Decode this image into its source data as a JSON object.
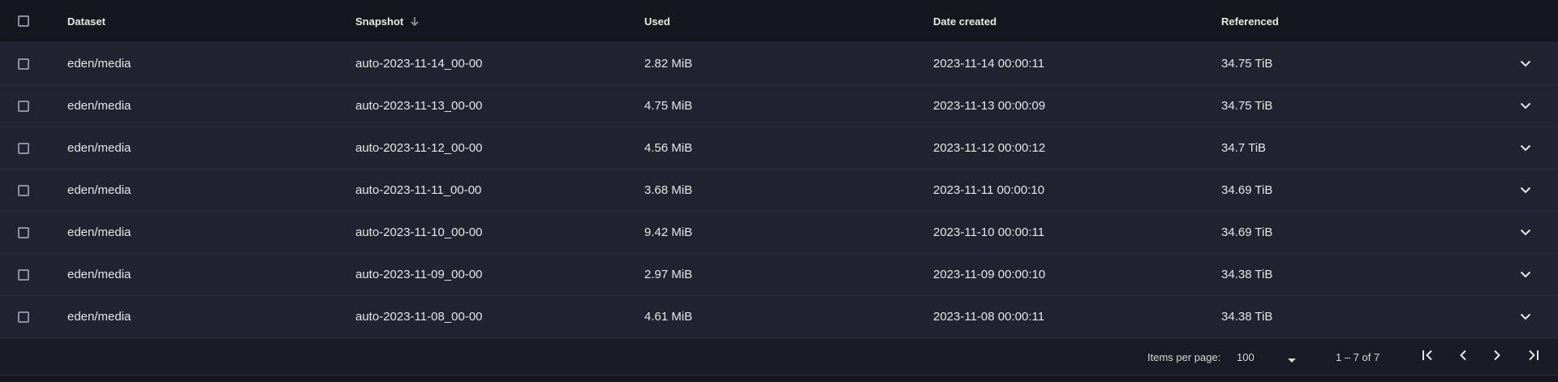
{
  "table": {
    "columns": {
      "dataset": "Dataset",
      "snapshot": "Snapshot",
      "used": "Used",
      "date_created": "Date created",
      "referenced": "Referenced"
    },
    "sort": {
      "column": "snapshot",
      "direction": "descending",
      "icon": "arrow-down-icon"
    },
    "rows": [
      {
        "dataset": "eden/media",
        "snapshot": "auto-2023-11-14_00-00",
        "used": "2.82 MiB",
        "date_created": "2023-11-14 00:00:11",
        "referenced": "34.75 TiB"
      },
      {
        "dataset": "eden/media",
        "snapshot": "auto-2023-11-13_00-00",
        "used": "4.75 MiB",
        "date_created": "2023-11-13 00:00:09",
        "referenced": "34.75 TiB"
      },
      {
        "dataset": "eden/media",
        "snapshot": "auto-2023-11-12_00-00",
        "used": "4.56 MiB",
        "date_created": "2023-11-12 00:00:12",
        "referenced": "34.7 TiB"
      },
      {
        "dataset": "eden/media",
        "snapshot": "auto-2023-11-11_00-00",
        "used": "3.68 MiB",
        "date_created": "2023-11-11 00:00:10",
        "referenced": "34.69 TiB"
      },
      {
        "dataset": "eden/media",
        "snapshot": "auto-2023-11-10_00-00",
        "used": "9.42 MiB",
        "date_created": "2023-11-10 00:00:11",
        "referenced": "34.69 TiB"
      },
      {
        "dataset": "eden/media",
        "snapshot": "auto-2023-11-09_00-00",
        "used": "2.97 MiB",
        "date_created": "2023-11-09 00:00:10",
        "referenced": "34.38 TiB"
      },
      {
        "dataset": "eden/media",
        "snapshot": "auto-2023-11-08_00-00",
        "used": "4.61 MiB",
        "date_created": "2023-11-08 00:00:11",
        "referenced": "34.38 TiB"
      }
    ]
  },
  "paginator": {
    "items_per_page_label": "Items per page:",
    "items_per_page_value": "100",
    "range_label": "1 – 7 of 7"
  },
  "colors": {
    "background": "#1a1b26",
    "row_background": "#222330",
    "header_background": "#15161e",
    "text": "#e6e6e6",
    "checkbox_border": "#8a8fa6"
  }
}
